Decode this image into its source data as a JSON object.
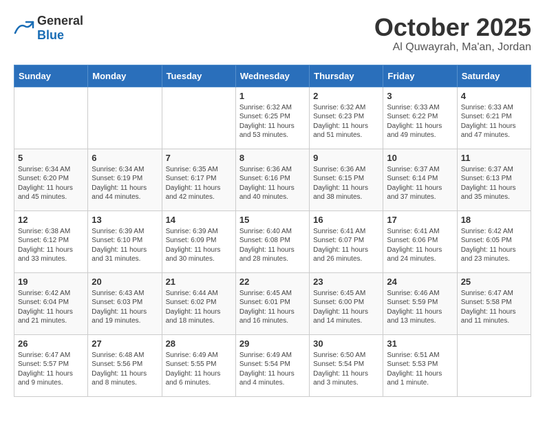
{
  "header": {
    "logo_general": "General",
    "logo_blue": "Blue",
    "month_title": "October 2025",
    "location": "Al Quwayrah, Ma'an, Jordan"
  },
  "weekdays": [
    "Sunday",
    "Monday",
    "Tuesday",
    "Wednesday",
    "Thursday",
    "Friday",
    "Saturday"
  ],
  "weeks": [
    [
      {
        "day": "",
        "info": ""
      },
      {
        "day": "",
        "info": ""
      },
      {
        "day": "",
        "info": ""
      },
      {
        "day": "1",
        "info": "Sunrise: 6:32 AM\nSunset: 6:25 PM\nDaylight: 11 hours and 53 minutes."
      },
      {
        "day": "2",
        "info": "Sunrise: 6:32 AM\nSunset: 6:23 PM\nDaylight: 11 hours and 51 minutes."
      },
      {
        "day": "3",
        "info": "Sunrise: 6:33 AM\nSunset: 6:22 PM\nDaylight: 11 hours and 49 minutes."
      },
      {
        "day": "4",
        "info": "Sunrise: 6:33 AM\nSunset: 6:21 PM\nDaylight: 11 hours and 47 minutes."
      }
    ],
    [
      {
        "day": "5",
        "info": "Sunrise: 6:34 AM\nSunset: 6:20 PM\nDaylight: 11 hours and 45 minutes."
      },
      {
        "day": "6",
        "info": "Sunrise: 6:34 AM\nSunset: 6:19 PM\nDaylight: 11 hours and 44 minutes."
      },
      {
        "day": "7",
        "info": "Sunrise: 6:35 AM\nSunset: 6:17 PM\nDaylight: 11 hours and 42 minutes."
      },
      {
        "day": "8",
        "info": "Sunrise: 6:36 AM\nSunset: 6:16 PM\nDaylight: 11 hours and 40 minutes."
      },
      {
        "day": "9",
        "info": "Sunrise: 6:36 AM\nSunset: 6:15 PM\nDaylight: 11 hours and 38 minutes."
      },
      {
        "day": "10",
        "info": "Sunrise: 6:37 AM\nSunset: 6:14 PM\nDaylight: 11 hours and 37 minutes."
      },
      {
        "day": "11",
        "info": "Sunrise: 6:37 AM\nSunset: 6:13 PM\nDaylight: 11 hours and 35 minutes."
      }
    ],
    [
      {
        "day": "12",
        "info": "Sunrise: 6:38 AM\nSunset: 6:12 PM\nDaylight: 11 hours and 33 minutes."
      },
      {
        "day": "13",
        "info": "Sunrise: 6:39 AM\nSunset: 6:10 PM\nDaylight: 11 hours and 31 minutes."
      },
      {
        "day": "14",
        "info": "Sunrise: 6:39 AM\nSunset: 6:09 PM\nDaylight: 11 hours and 30 minutes."
      },
      {
        "day": "15",
        "info": "Sunrise: 6:40 AM\nSunset: 6:08 PM\nDaylight: 11 hours and 28 minutes."
      },
      {
        "day": "16",
        "info": "Sunrise: 6:41 AM\nSunset: 6:07 PM\nDaylight: 11 hours and 26 minutes."
      },
      {
        "day": "17",
        "info": "Sunrise: 6:41 AM\nSunset: 6:06 PM\nDaylight: 11 hours and 24 minutes."
      },
      {
        "day": "18",
        "info": "Sunrise: 6:42 AM\nSunset: 6:05 PM\nDaylight: 11 hours and 23 minutes."
      }
    ],
    [
      {
        "day": "19",
        "info": "Sunrise: 6:42 AM\nSunset: 6:04 PM\nDaylight: 11 hours and 21 minutes."
      },
      {
        "day": "20",
        "info": "Sunrise: 6:43 AM\nSunset: 6:03 PM\nDaylight: 11 hours and 19 minutes."
      },
      {
        "day": "21",
        "info": "Sunrise: 6:44 AM\nSunset: 6:02 PM\nDaylight: 11 hours and 18 minutes."
      },
      {
        "day": "22",
        "info": "Sunrise: 6:45 AM\nSunset: 6:01 PM\nDaylight: 11 hours and 16 minutes."
      },
      {
        "day": "23",
        "info": "Sunrise: 6:45 AM\nSunset: 6:00 PM\nDaylight: 11 hours and 14 minutes."
      },
      {
        "day": "24",
        "info": "Sunrise: 6:46 AM\nSunset: 5:59 PM\nDaylight: 11 hours and 13 minutes."
      },
      {
        "day": "25",
        "info": "Sunrise: 6:47 AM\nSunset: 5:58 PM\nDaylight: 11 hours and 11 minutes."
      }
    ],
    [
      {
        "day": "26",
        "info": "Sunrise: 6:47 AM\nSunset: 5:57 PM\nDaylight: 11 hours and 9 minutes."
      },
      {
        "day": "27",
        "info": "Sunrise: 6:48 AM\nSunset: 5:56 PM\nDaylight: 11 hours and 8 minutes."
      },
      {
        "day": "28",
        "info": "Sunrise: 6:49 AM\nSunset: 5:55 PM\nDaylight: 11 hours and 6 minutes."
      },
      {
        "day": "29",
        "info": "Sunrise: 6:49 AM\nSunset: 5:54 PM\nDaylight: 11 hours and 4 minutes."
      },
      {
        "day": "30",
        "info": "Sunrise: 6:50 AM\nSunset: 5:54 PM\nDaylight: 11 hours and 3 minutes."
      },
      {
        "day": "31",
        "info": "Sunrise: 6:51 AM\nSunset: 5:53 PM\nDaylight: 11 hours and 1 minute."
      },
      {
        "day": "",
        "info": ""
      }
    ]
  ]
}
